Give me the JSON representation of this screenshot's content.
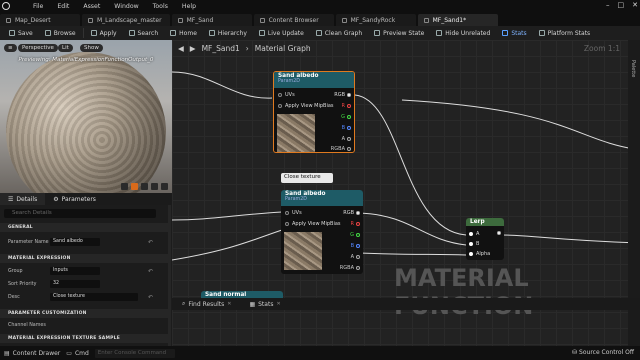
{
  "menubar": {
    "items": [
      "File",
      "Edit",
      "Asset",
      "Window",
      "Tools",
      "Help"
    ]
  },
  "tabs": [
    {
      "label": "Map_Desert"
    },
    {
      "label": "M_Landscape_master"
    },
    {
      "label": "MF_Sand"
    },
    {
      "label": "Content Browser"
    },
    {
      "label": "MF_SandyRock"
    },
    {
      "label": "MF_Sand1*"
    }
  ],
  "toolbar": {
    "save": "Save",
    "browse": "Browse",
    "apply": "Apply",
    "search": "Search",
    "home": "Home",
    "hierarchy": "Hierarchy",
    "live_update": "Live Update",
    "clean_graph": "Clean Graph",
    "preview_state": "Preview State",
    "hide_unrelated": "Hide Unrelated",
    "stats": "Stats",
    "platform_stats": "Platform Stats"
  },
  "viewport": {
    "perspective": "Perspective",
    "lit": "Lit",
    "show": "Show",
    "previewing": "Previewing: MaterialExpressionFunctionOutput_0"
  },
  "details_tabs": {
    "details": "Details",
    "parameters": "Parameters"
  },
  "details": {
    "search_placeholder": "Search Details",
    "general": "GENERAL",
    "param_name_label": "Parameter Name",
    "param_name_value": "Sand albedo",
    "material_expression": "MATERIAL EXPRESSION",
    "group_label": "Group",
    "group_value": "Inputs",
    "sort_label": "Sort Priority",
    "sort_value": "32",
    "desc_label": "Desc",
    "desc_value": "Close texture",
    "param_custom": "PARAMETER CUSTOMIZATION",
    "channel_names": "Channel Names",
    "tex_sample": "MATERIAL EXPRESSION TEXTURE SAMPLE"
  },
  "graph": {
    "breadcrumb_root": "MF_Sand1",
    "breadcrumb_leaf": "Material Graph",
    "zoom": "Zoom 1:1",
    "palette": "Palette",
    "watermark": "MATERIAL FUNCTION",
    "comment": "Close texture"
  },
  "node1": {
    "title": "Sand albedo",
    "subtitle": "Param2D",
    "uvs": "UVs",
    "mip": "Apply View MipBias",
    "rgb": "RGB",
    "r": "R",
    "g": "G",
    "b": "B",
    "a": "A",
    "rgba": "RGBA"
  },
  "node2": {
    "title": "Sand albedo",
    "subtitle": "Param2D",
    "uvs": "UVs",
    "mip": "Apply View MipBias",
    "rgb": "RGB",
    "r": "R",
    "g": "G",
    "b": "B",
    "a": "A",
    "rgba": "RGBA"
  },
  "node3": {
    "title": "Sand normal"
  },
  "lerp": {
    "title": "Lerp",
    "a": "A",
    "b": "B",
    "alpha": "Alpha"
  },
  "bottom_tabs": {
    "find": "Find Results",
    "stats": "Stats"
  },
  "statusbar": {
    "content_drawer": "Content Drawer",
    "cmd": "Cmd",
    "console_placeholder": "Enter Console Command",
    "source_control": "Source Control Off"
  },
  "colors": {
    "accent": "#e07a1f",
    "node_header": "#1e5b66",
    "lerp_header": "#3d6b3d"
  }
}
